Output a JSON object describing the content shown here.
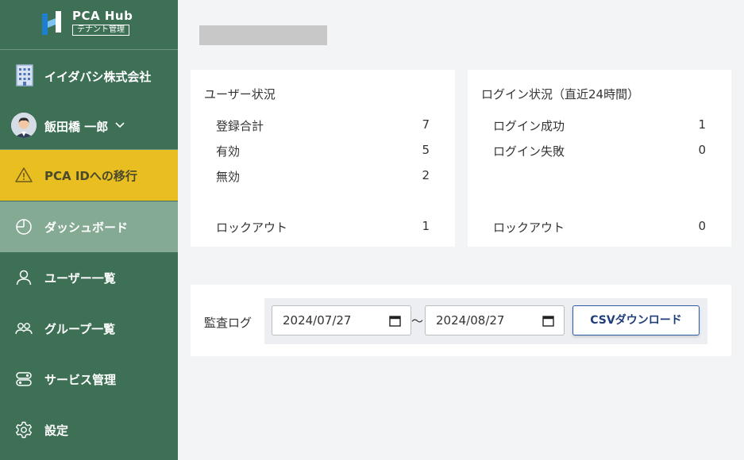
{
  "brand": {
    "title": "PCA Hub",
    "subtitle": "テナント管理"
  },
  "tenant": {
    "name": "イイダバシ株式会社",
    "icon": "building-icon"
  },
  "user": {
    "name": "飯田橋 一郎",
    "icon": "avatar"
  },
  "nav": [
    {
      "label": "PCA IDへの移行",
      "icon": "warning-icon",
      "state": "warning"
    },
    {
      "label": "ダッシュボード",
      "icon": "dashboard-icon",
      "state": "active"
    },
    {
      "label": "ユーザー一覧",
      "icon": "user-icon",
      "state": "normal"
    },
    {
      "label": "グループ一覧",
      "icon": "group-icon",
      "state": "normal"
    },
    {
      "label": "サービス管理",
      "icon": "service-icon",
      "state": "normal"
    },
    {
      "label": "設定",
      "icon": "gear-icon",
      "state": "normal"
    }
  ],
  "user_status": {
    "title": "ユーザー状況",
    "rows": [
      {
        "label": "登録合計",
        "value": "7"
      },
      {
        "label": "有効",
        "value": "5"
      },
      {
        "label": "無効",
        "value": "2"
      },
      {
        "label": "ロックアウト",
        "value": "1"
      }
    ]
  },
  "login_status": {
    "title": "ログイン状況（直近24時間）",
    "rows": [
      {
        "label": "ログイン成功",
        "value": "1"
      },
      {
        "label": "ログイン失敗",
        "value": "0"
      },
      {
        "label": "ロックアウト",
        "value": "0"
      }
    ]
  },
  "audit": {
    "label": "監査ログ",
    "from": "2024/07/27",
    "to": "2024/08/27",
    "separator": "～",
    "button": "CSVダウンロード"
  },
  "colors": {
    "sidebar": "#3e7056",
    "warning": "#e8be21",
    "active": "#85aa94",
    "accent": "#2f5aa8"
  }
}
